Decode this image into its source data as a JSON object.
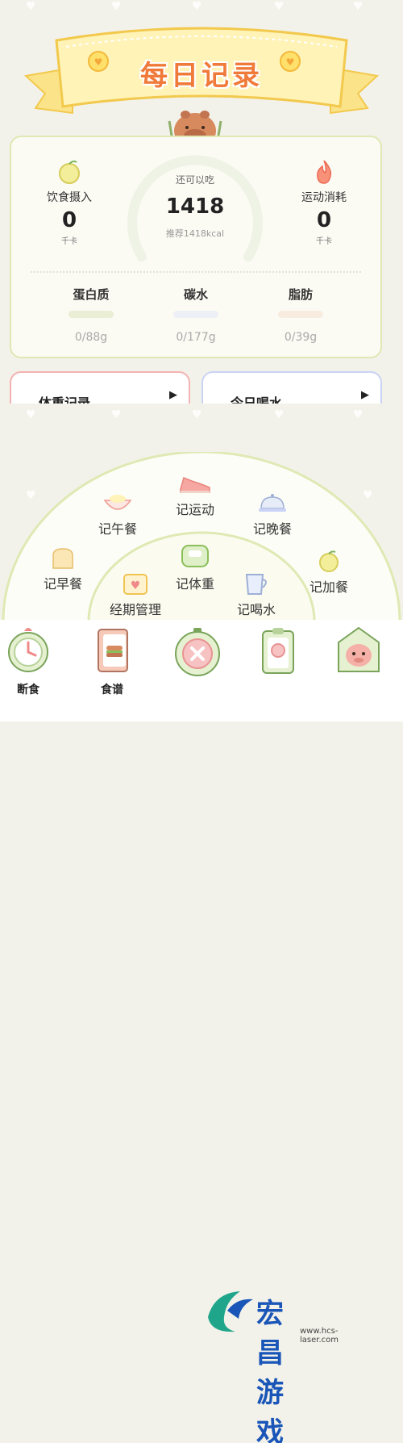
{
  "header": {
    "title": "每日记录"
  },
  "summary": {
    "intake": {
      "label": "饮食摄入",
      "value": "0",
      "unit": "千卡"
    },
    "center": {
      "label": "还可以吃",
      "value": "1418",
      "recommend": "推荐1418kcal"
    },
    "burn": {
      "label": "运动消耗",
      "value": "0",
      "unit": "千卡"
    },
    "macros": [
      {
        "name": "蛋白质",
        "value": "0/88g",
        "color": "#e9eed4"
      },
      {
        "name": "碳水",
        "value": "0/177g",
        "color": "#eef0f8"
      },
      {
        "name": "脂肪",
        "value": "0/39g",
        "color": "#f8ece0"
      }
    ]
  },
  "tiles": [
    {
      "label": "体重记录",
      "border": "#f4b2b2"
    },
    {
      "label": "今日喝水",
      "border": "#c9d3f5"
    }
  ],
  "menu": {
    "items": [
      {
        "label": "记运动",
        "icon": "sneaker-icon"
      },
      {
        "label": "记午餐",
        "icon": "bowl-icon"
      },
      {
        "label": "记晚餐",
        "icon": "cloche-icon"
      },
      {
        "label": "记早餐",
        "icon": "toast-icon"
      },
      {
        "label": "记体重",
        "icon": "scale-icon"
      },
      {
        "label": "记加餐",
        "icon": "fruit-icon"
      },
      {
        "label": "经期管理",
        "icon": "calendar-heart-icon"
      },
      {
        "label": "记喝水",
        "icon": "cup-icon"
      }
    ]
  },
  "tabbar": {
    "tabs": [
      {
        "label": "断食",
        "icon": "clock-icon"
      },
      {
        "label": "食谱",
        "icon": "recipe-book-icon"
      },
      {
        "label": "",
        "icon": "close-round-icon"
      },
      {
        "label": "",
        "icon": "clipboard-icon"
      },
      {
        "label": "",
        "icon": "mascot-icon"
      }
    ]
  },
  "watermark": {
    "text": "宏昌游戏网",
    "url": "www.hcs-laser.com"
  }
}
